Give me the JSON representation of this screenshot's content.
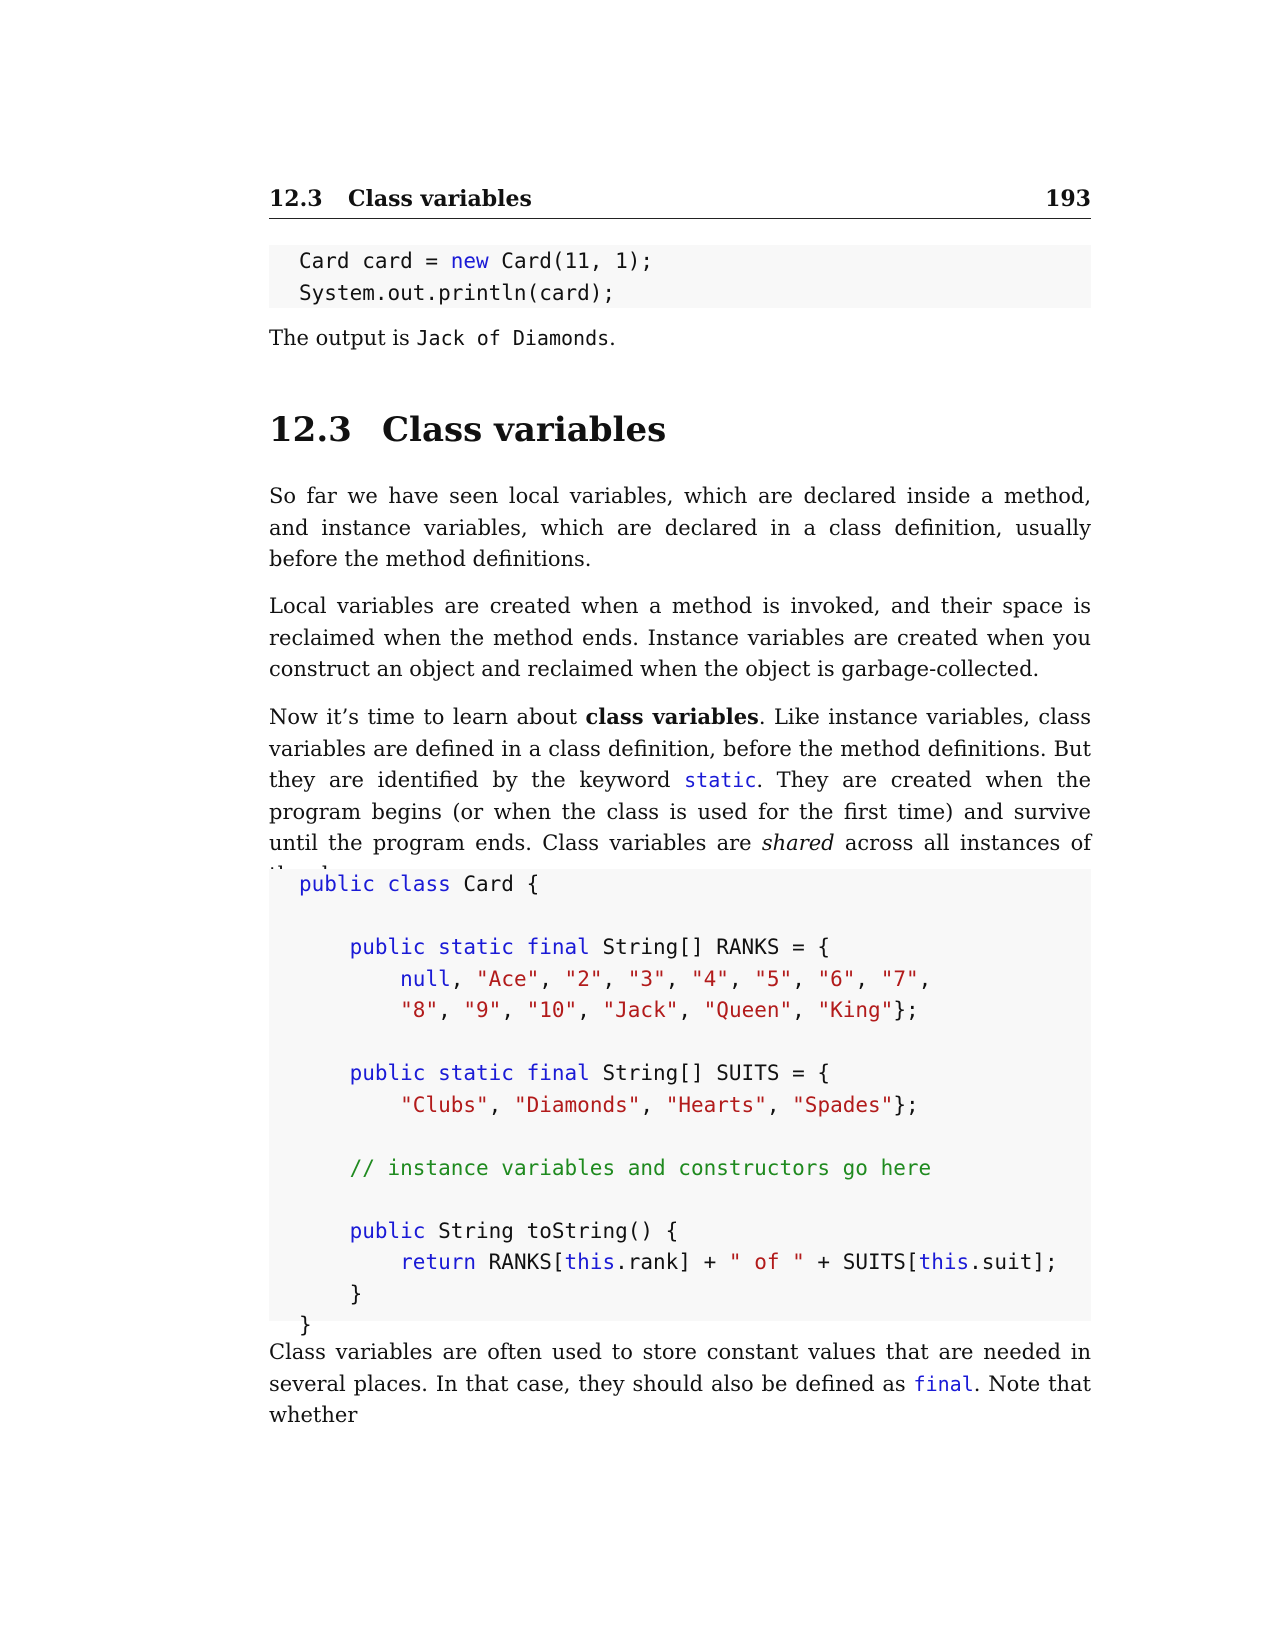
{
  "running_head": {
    "section_number": "12.3",
    "section_title": "Class variables",
    "page_number": "193"
  },
  "code_block_1": {
    "line1": {
      "p1": "Card card = ",
      "kw": "new",
      "p2": " Card(11, 1);"
    },
    "line2": "System.out.println(card);"
  },
  "output_sentence": {
    "prefix": "The output is ",
    "code": "Jack of Diamonds",
    "suffix": "."
  },
  "section": {
    "number": "12.3",
    "title": "Class variables"
  },
  "paragraph_1": "So far we have seen local variables, which are declared inside a method, and instance variables, which are declared in a class definition, usually before the method definitions.",
  "paragraph_2": "Local variables are created when a method is invoked, and their space is reclaimed when the method ends. Instance variables are created when you construct an object and reclaimed when the object is garbage-collected.",
  "paragraph_3": {
    "t1": "Now it’s time to learn about ",
    "bold": "class variables",
    "t2": ". Like instance variables, class variables are defined in a class definition, before the method definitions. But they are identified by the keyword ",
    "code": "static",
    "t3": ". They are created when the program begins (or when the class is used for the first time) and survive until the program ends. Class variables are ",
    "italic": "shared",
    "t4": " across all instances of the class."
  },
  "code_block_2": {
    "l1": {
      "kw1": "public",
      "kw2": "class",
      "rest": " Card {"
    },
    "l3": {
      "indent": "    ",
      "kw1": "public",
      "kw2": "static",
      "kw3": "final",
      "rest": " String[] RANKS = {"
    },
    "l4": {
      "indent": "        ",
      "kw": "null",
      "s1": "\"Ace\"",
      "s2": "\"2\"",
      "s3": "\"3\"",
      "s4": "\"4\"",
      "s5": "\"5\"",
      "s6": "\"6\"",
      "s7": "\"7\""
    },
    "l5": {
      "indent": "        ",
      "s1": "\"8\"",
      "s2": "\"9\"",
      "s3": "\"10\"",
      "s4": "\"Jack\"",
      "s5": "\"Queen\"",
      "s6": "\"King\"",
      "end": "};"
    },
    "l7": {
      "indent": "    ",
      "kw1": "public",
      "kw2": "static",
      "kw3": "final",
      "rest": " String[] SUITS = {"
    },
    "l8": {
      "indent": "        ",
      "s1": "\"Clubs\"",
      "s2": "\"Diamonds\"",
      "s3": "\"Hearts\"",
      "s4": "\"Spades\"",
      "end": "};"
    },
    "l10": {
      "indent": "    ",
      "comment": "// instance variables and constructors go here"
    },
    "l12": {
      "indent": "    ",
      "kw": "public",
      "rest": " String toString() {"
    },
    "l13": {
      "indent": "        ",
      "kw1": "return",
      "p1": " RANKS[",
      "kw2": "this",
      "p2": ".rank] + ",
      "str": "\" of \"",
      "p3": " + SUITS[",
      "kw3": "this",
      "p4": ".suit];"
    },
    "l14": {
      "indent": "    ",
      "text": "}"
    },
    "l15": "}"
  },
  "paragraph_4": {
    "t1": "Class variables are often used to store constant values that are needed in several places. In that case, they should also be defined as ",
    "code": "final",
    "t2": ". Note that whether"
  }
}
